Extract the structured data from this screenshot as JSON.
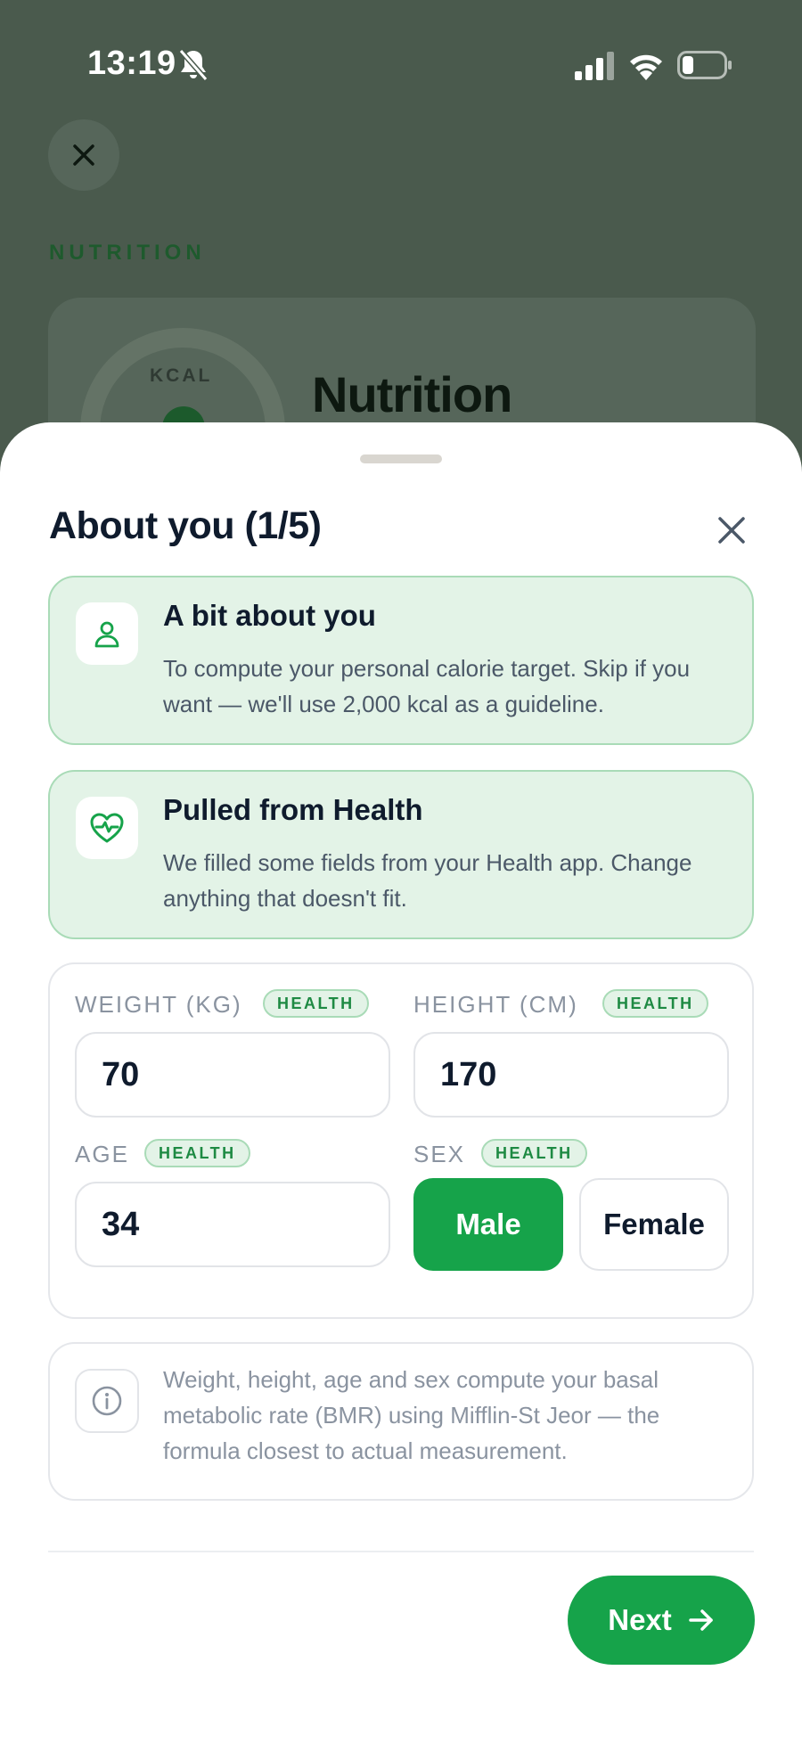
{
  "status_bar": {
    "time": "13:19",
    "icons": [
      "bell-slash-icon",
      "cellular-signal-icon",
      "wifi-icon",
      "battery-icon"
    ]
  },
  "background": {
    "section_label": "NUTRITION",
    "ring_label": "KCAL",
    "card_title": "Nutrition"
  },
  "sheet": {
    "title": "About you (1/5)",
    "intro_card": {
      "icon": "person-icon",
      "title": "A bit about you",
      "body": "To compute your personal calorie target. Skip if you want — we'll use 2,000 kcal as a guideline."
    },
    "health_card": {
      "icon": "heart-pulse-icon",
      "title": "Pulled from Health",
      "body": "We filled some fields from your Health app. Change anything that doesn't fit."
    },
    "fields": {
      "weight": {
        "label": "WEIGHT (KG)",
        "badge": "HEALTH",
        "value": "70"
      },
      "height": {
        "label": "HEIGHT (CM)",
        "badge": "HEALTH",
        "value": "170"
      },
      "age": {
        "label": "AGE",
        "badge": "HEALTH",
        "value": "34"
      },
      "sex": {
        "label": "SEX",
        "badge": "HEALTH",
        "options": [
          "Male",
          "Female"
        ],
        "selected": "Male"
      }
    },
    "note": {
      "icon": "info-icon",
      "body": "Weight, height, age and sex compute your basal metabolic rate (BMR) using Mifflin-St Jeor — the formula closest to actual measurement."
    },
    "next_label": "Next"
  },
  "colors": {
    "accent": "#16a34a",
    "accent_soft": "#e3f3e7",
    "accent_border": "#a9dbb7",
    "overlay": "#4a5a4d"
  }
}
